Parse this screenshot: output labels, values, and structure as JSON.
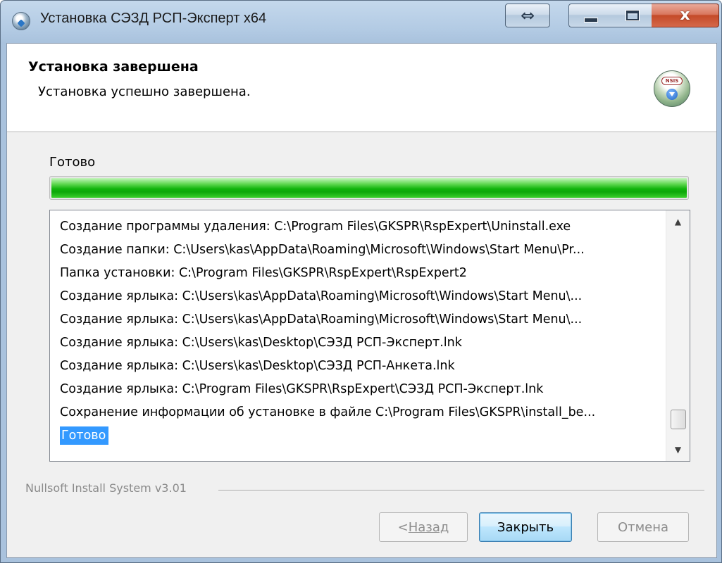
{
  "window": {
    "title": "Установка СЭЗД РСП-Эксперт x64",
    "close_glyph": "x",
    "resize_glyph": "⇔"
  },
  "header": {
    "title": "Установка завершена",
    "subtitle": "Установка успешно завершена.",
    "logo_text": "NSIS"
  },
  "status": {
    "label": "Готово",
    "progress": 1.0
  },
  "log": {
    "lines": [
      "Создание программы удаления: C:\\Program Files\\GKSPR\\RspExpert\\Uninstall.exe",
      "Создание папки: C:\\Users\\kas\\AppData\\Roaming\\Microsoft\\Windows\\Start Menu\\Pr...",
      "Папка установки: C:\\Program Files\\GKSPR\\RspExpert\\RspExpert2",
      "Создание ярлыка: C:\\Users\\kas\\AppData\\Roaming\\Microsoft\\Windows\\Start Menu\\...",
      "Создание ярлыка: C:\\Users\\kas\\AppData\\Roaming\\Microsoft\\Windows\\Start Menu\\...",
      "Создание ярлыка: C:\\Users\\kas\\Desktop\\СЭЗД РСП-Эксперт.lnk",
      "Создание ярлыка: C:\\Users\\kas\\Desktop\\СЭЗД РСП-Анкета.lnk",
      "Создание ярлыка: C:\\Program Files\\GKSPR\\RspExpert\\СЭЗД РСП-Эксперт.lnk",
      "Сохранение информации об установке в файле C:\\Program Files\\GKSPR\\install_be...",
      "Готово"
    ],
    "selected_index": 9,
    "scroll_position": 0.95
  },
  "footer": {
    "branding": "Nullsoft Install System v3.01",
    "back_prefix": "< ",
    "back_label": "Назад",
    "close_label": "Закрыть",
    "cancel_label": "Отмена"
  },
  "colors": {
    "selection": "#3399ff",
    "progress": "#11b40c",
    "close_button": "#c44a28"
  }
}
